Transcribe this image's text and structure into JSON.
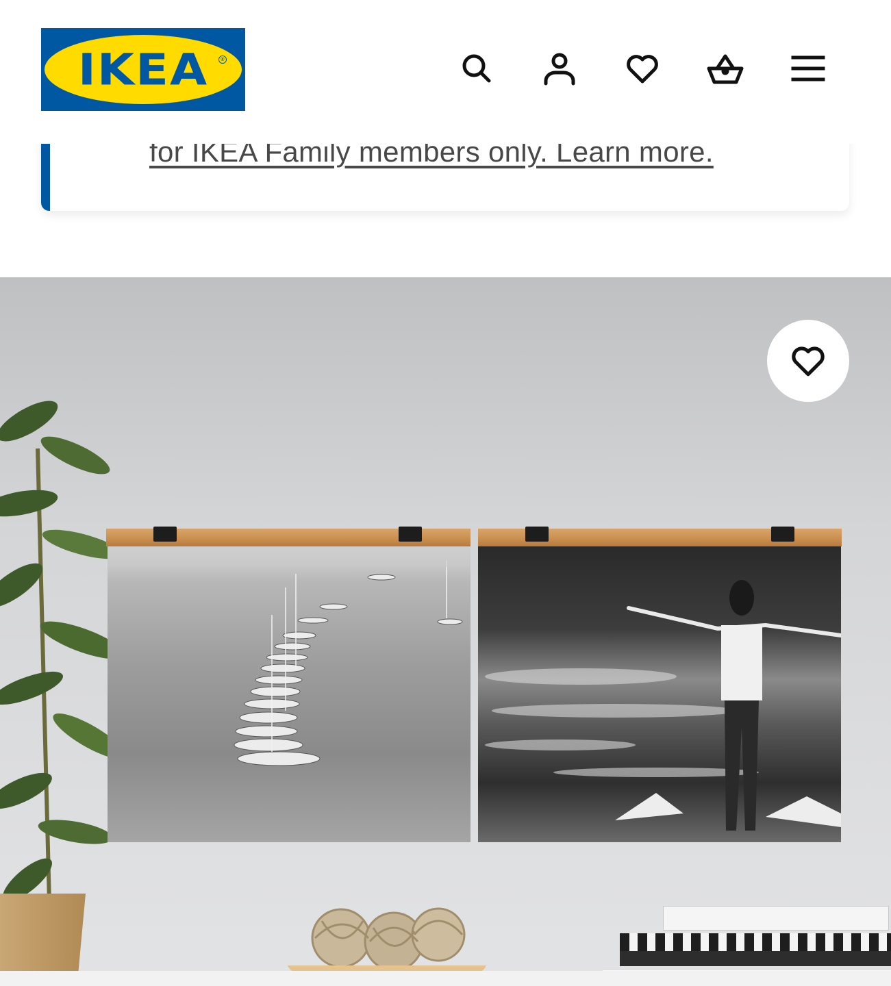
{
  "header": {
    "logo_text": "IKEA",
    "logo_registered": "®",
    "icons": [
      "search-icon",
      "account-icon",
      "favourites-icon",
      "cart-icon",
      "menu-icon"
    ]
  },
  "banner": {
    "link_text": "for IKEA Family members only. Learn more."
  },
  "product": {
    "favourite_icon": "heart-outline-icon"
  },
  "colors": {
    "ikea_blue": "#0058a3",
    "ikea_yellow": "#ffdb00",
    "text_dark": "#111111",
    "link_gray": "#484848"
  }
}
